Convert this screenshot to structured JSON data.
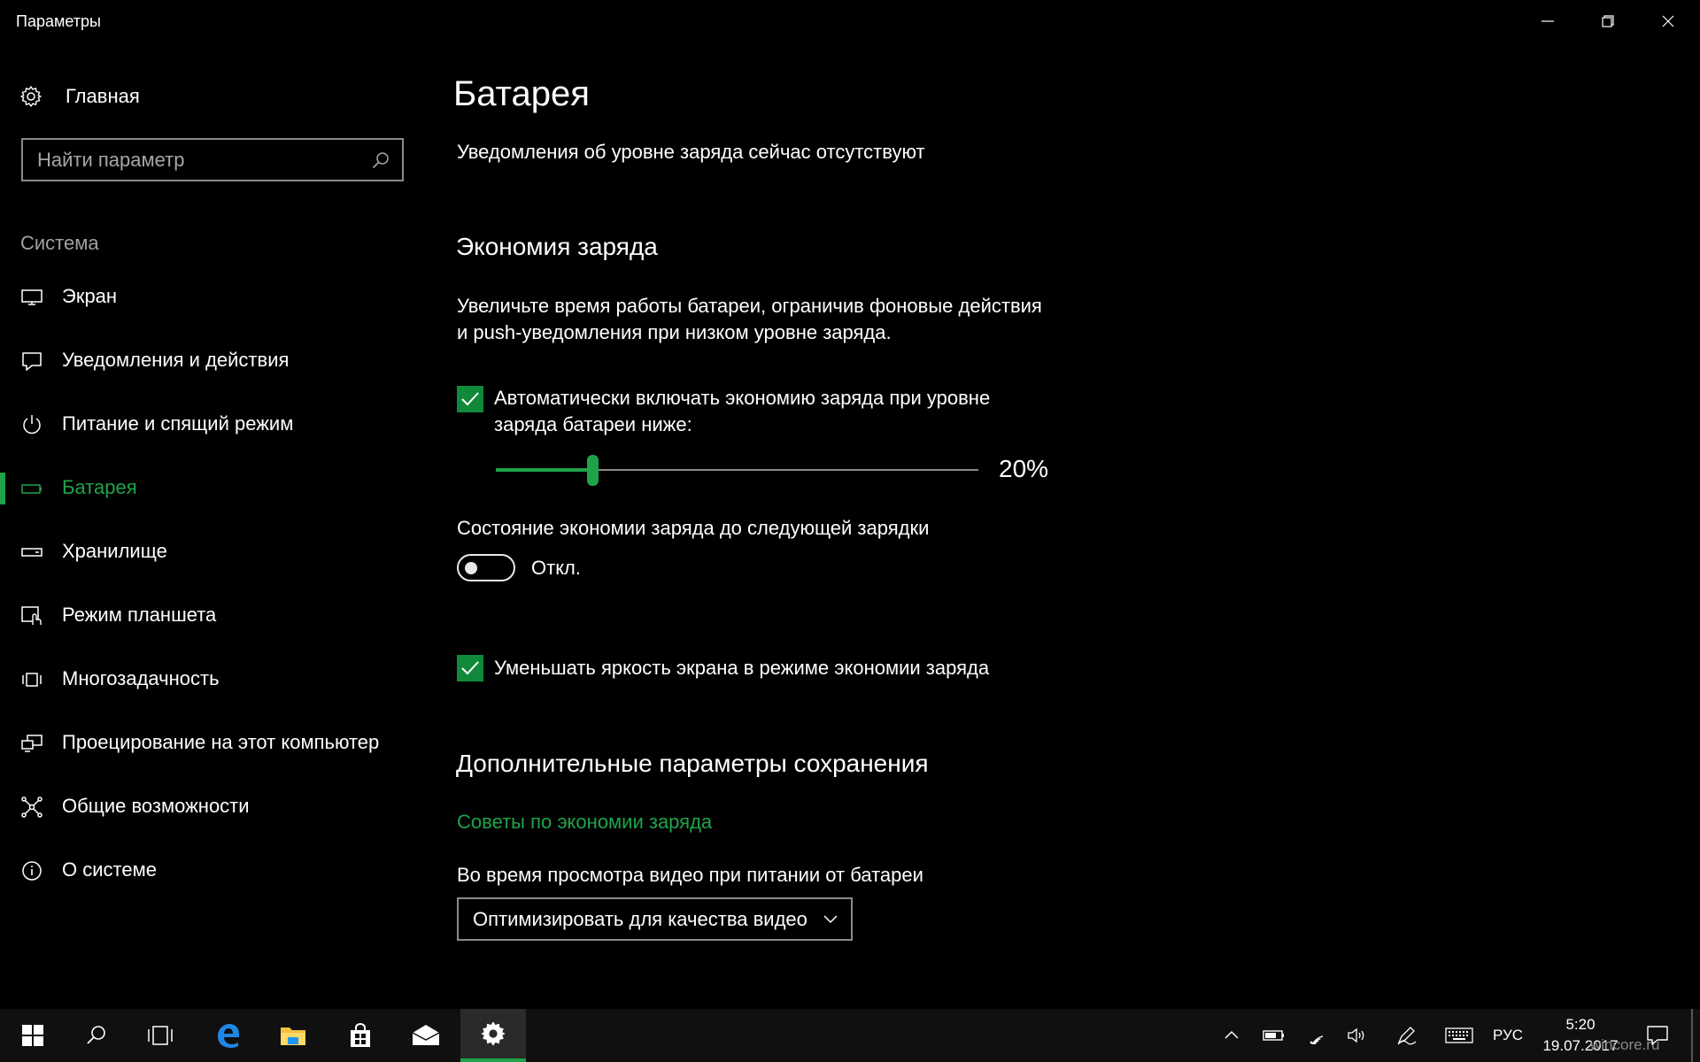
{
  "window": {
    "title": "Параметры"
  },
  "sidebar": {
    "home_label": "Главная",
    "search_placeholder": "Найти параметр",
    "section_label": "Система",
    "items": [
      {
        "label": "Экран",
        "icon": "monitor-icon"
      },
      {
        "label": "Уведомления и действия",
        "icon": "notification-icon"
      },
      {
        "label": "Питание и спящий режим",
        "icon": "power-icon"
      },
      {
        "label": "Батарея",
        "icon": "battery-icon",
        "active": true
      },
      {
        "label": "Хранилище",
        "icon": "storage-icon"
      },
      {
        "label": "Режим планшета",
        "icon": "tablet-mode-icon"
      },
      {
        "label": "Многозадачность",
        "icon": "multitasking-icon"
      },
      {
        "label": "Проецирование на этот компьютер",
        "icon": "projecting-icon"
      },
      {
        "label": "Общие возможности",
        "icon": "shared-experiences-icon"
      },
      {
        "label": "О системе",
        "icon": "info-icon"
      }
    ]
  },
  "main": {
    "title": "Батарея",
    "notification_status": "Уведомления об уровне заряда сейчас отсутствуют",
    "saver_heading": "Экономия заряда",
    "saver_desc_line1": "Увеличьте время работы батареи, ограничив фоновые действия",
    "saver_desc_line2": "и push-уведомления при низком уровне заряда.",
    "auto_saver_label_line1": "Автоматически включать экономию заряда при уровне",
    "auto_saver_label_line2": "заряда батареи ниже:",
    "auto_saver_checked": true,
    "threshold_value": 20,
    "threshold_display": "20%",
    "status_label": "Состояние экономии заряда до следующей зарядки",
    "status_toggle_on": false,
    "status_toggle_text": "Откл.",
    "brightness_label": "Уменьшать яркость экрана в режиме экономии заряда",
    "brightness_checked": true,
    "extra_heading": "Дополнительные параметры сохранения",
    "tips_link": "Советы по экономии заряда",
    "video_label": "Во время просмотра видео при питании от батареи",
    "video_selected": "Оптимизировать для качества видео"
  },
  "taskbar": {
    "language": "РУС",
    "time": "5:20",
    "date": "19.07.2017",
    "watermark": "wincore.ru"
  },
  "colors": {
    "accent": "#1fa34a",
    "checkbox": "#108a3a",
    "background": "#000000"
  }
}
